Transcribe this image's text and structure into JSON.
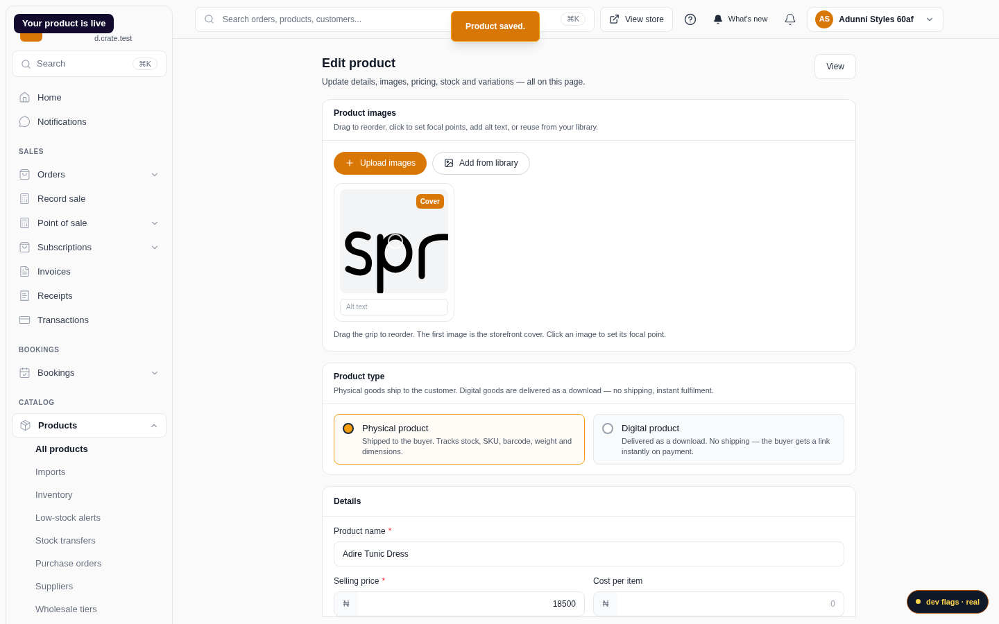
{
  "sidebar": {
    "store_domain": "d.crate.test",
    "tooltip": "Your product is live",
    "search": {
      "placeholder": "Search",
      "shortcut": "⌘K"
    },
    "sections": [
      {
        "items": [
          {
            "label": "Home",
            "kind": "link"
          },
          {
            "label": "Notifications",
            "kind": "link"
          }
        ]
      },
      {
        "title": "SALES",
        "items": [
          {
            "label": "Orders",
            "kind": "group",
            "expanded": false
          },
          {
            "label": "Record sale",
            "kind": "link"
          },
          {
            "label": "Point of sale",
            "kind": "group",
            "expanded": false
          },
          {
            "label": "Subscriptions",
            "kind": "group",
            "expanded": false
          },
          {
            "label": "Invoices",
            "kind": "link"
          },
          {
            "label": "Receipts",
            "kind": "link"
          },
          {
            "label": "Transactions",
            "kind": "link"
          }
        ]
      },
      {
        "title": "BOOKINGS",
        "items": [
          {
            "label": "Bookings",
            "kind": "group",
            "expanded": false
          }
        ]
      },
      {
        "title": "CATALOG",
        "items": [
          {
            "label": "Products",
            "kind": "group",
            "expanded": true,
            "children": [
              {
                "label": "All products",
                "selected": true
              },
              {
                "label": "Imports",
                "selected": false
              },
              {
                "label": "Inventory",
                "selected": false
              },
              {
                "label": "Low-stock alerts",
                "selected": false
              },
              {
                "label": "Stock transfers",
                "selected": false
              },
              {
                "label": "Purchase orders",
                "selected": false
              },
              {
                "label": "Suppliers",
                "selected": false
              },
              {
                "label": "Wholesale tiers",
                "selected": false
              }
            ]
          }
        ]
      }
    ]
  },
  "header": {
    "search": {
      "placeholder": "Search orders, products, customers...",
      "shortcut": "⌘K"
    },
    "view_store": "View store",
    "whats_new": "What's new",
    "account": {
      "initials": "AS",
      "name": "Adunni Styles 60af"
    }
  },
  "toast": "Product saved.",
  "page": {
    "title": "Edit product",
    "subtitle": "Update details, images, pricing, stock and variations — all on this page.",
    "view_button": "View"
  },
  "images_card": {
    "title": "Product images",
    "description": "Drag to reorder, click to set focal points, add alt text, or reuse from your library.",
    "upload_button": "Upload images",
    "library_button": "Add from library",
    "images": [
      {
        "kind": "picture",
        "badge": "Cover",
        "alt_placeholder": "Alt text"
      }
    ],
    "hint": "Drag the grip to reorder. The first image is the storefront cover. Click an image to set its focal point."
  },
  "type_card": {
    "title": "Product type",
    "description": "Physical goods ship to the customer. Digital goods are delivered as a download — no shipping, instant fulfilment.",
    "options": [
      {
        "label": "Physical product",
        "description": "Shipped to the buyer. Tracks stock, SKU, barcode, weight and dimensions.",
        "selected": true
      },
      {
        "label": "Digital product",
        "description": "Delivered as a download. No shipping — the buyer gets a link instantly on payment.",
        "selected": false
      }
    ]
  },
  "details_card": {
    "title": "Details",
    "product_name": {
      "label": "Product name",
      "required_marker": "*",
      "value": "Adire Tunic Dress"
    },
    "prices": [
      {
        "label": "Selling price",
        "required_marker": "*",
        "currency": "₦",
        "value": "18500"
      },
      {
        "label": "Cost per item",
        "currency": "₦",
        "placeholder": "0"
      }
    ]
  },
  "dev_badge": "dev flags · real"
}
